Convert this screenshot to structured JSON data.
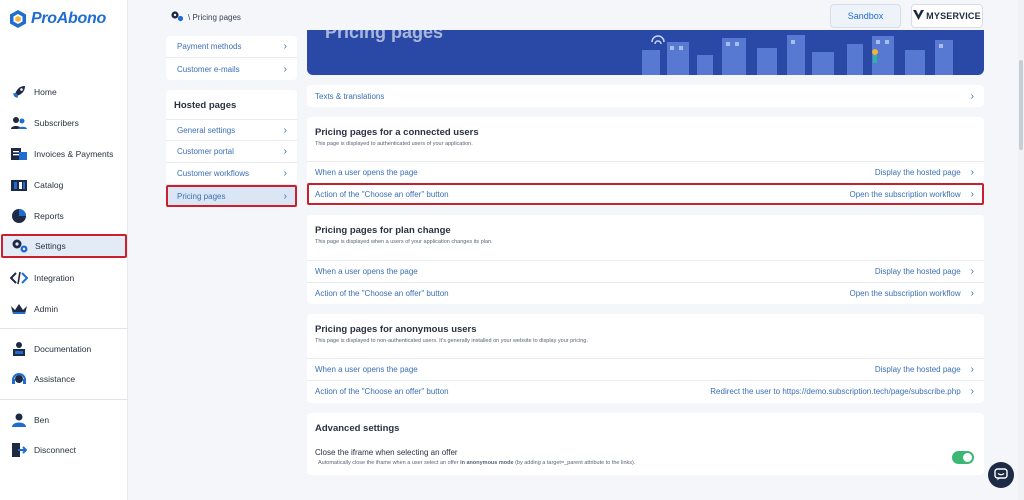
{
  "app": {
    "name": "ProAbono"
  },
  "colors": {
    "accent": "#1f6dd1",
    "highlight": "#cc1f2d",
    "banner": "#2a49a6",
    "toggle_on": "#3bb873"
  },
  "sidebar": {
    "items": [
      {
        "label": "Home",
        "icon": "rocket-icon"
      },
      {
        "label": "Subscribers",
        "icon": "users-icon"
      },
      {
        "label": "Invoices & Payments",
        "icon": "invoices-icon"
      },
      {
        "label": "Catalog",
        "icon": "catalog-icon"
      },
      {
        "label": "Reports",
        "icon": "pie-chart-icon"
      },
      {
        "label": "Settings",
        "icon": "gear-icon",
        "active": true
      },
      {
        "label": "Integration",
        "icon": "code-icon"
      },
      {
        "label": "Admin",
        "icon": "crown-icon"
      },
      {
        "label": "Documentation",
        "icon": "book-icon"
      },
      {
        "label": "Assistance",
        "icon": "headset-icon"
      },
      {
        "label": "Ben",
        "icon": "user-icon"
      },
      {
        "label": "Disconnect",
        "icon": "logout-icon"
      }
    ]
  },
  "header": {
    "breadcrumb": "\\ Pricing pages",
    "sandbox_label": "Sandbox",
    "brand_label": "MYSERVICE"
  },
  "submenu": {
    "top_items": [
      "Payment methods",
      "Customer e-mails"
    ],
    "hosted_title": "Hosted pages",
    "hosted_items": [
      "General settings",
      "Customer portal",
      "Customer workflows",
      "Pricing pages"
    ]
  },
  "main": {
    "banner_title": "Pricing pages",
    "texts_translations": "Texts & translations",
    "sections": [
      {
        "title": "Pricing pages for a connected users",
        "desc": "This page is displayed to authenticated users of your application.",
        "rows": [
          {
            "left": "When a user opens the page",
            "right": "Display the hosted page"
          },
          {
            "left": "Action of the \"Choose an offer\" button",
            "right": "Open the subscription workflow"
          }
        ]
      },
      {
        "title": "Pricing pages for plan change",
        "desc": "This page is displayed when a users of your application changes its plan.",
        "rows": [
          {
            "left": "When a user opens the page",
            "right": "Display the hosted page"
          },
          {
            "left": "Action of the \"Choose an offer\" button",
            "right": "Open the subscription workflow"
          }
        ]
      },
      {
        "title": "Pricing pages for anonymous users",
        "desc": "This page is displayed to non-authenticated users. It's generally installed on your website to display your pricing.",
        "rows": [
          {
            "left": "When a user opens the page",
            "right": "Display the hosted page"
          },
          {
            "left": "Action of the \"Choose an offer\" button",
            "right": "Redirect the user to https://demo.subscription.tech/page/subscribe.php"
          }
        ]
      }
    ],
    "advanced": {
      "title": "Advanced settings",
      "option_label": "Close the iframe when selecting an offer",
      "option_desc_1": "Automatically close the iframe when a user select an offer ",
      "option_desc_bold": "in anonymous mode",
      "option_desc_2": " (by adding a target=_parent attribute to the links).",
      "enabled": true
    }
  }
}
